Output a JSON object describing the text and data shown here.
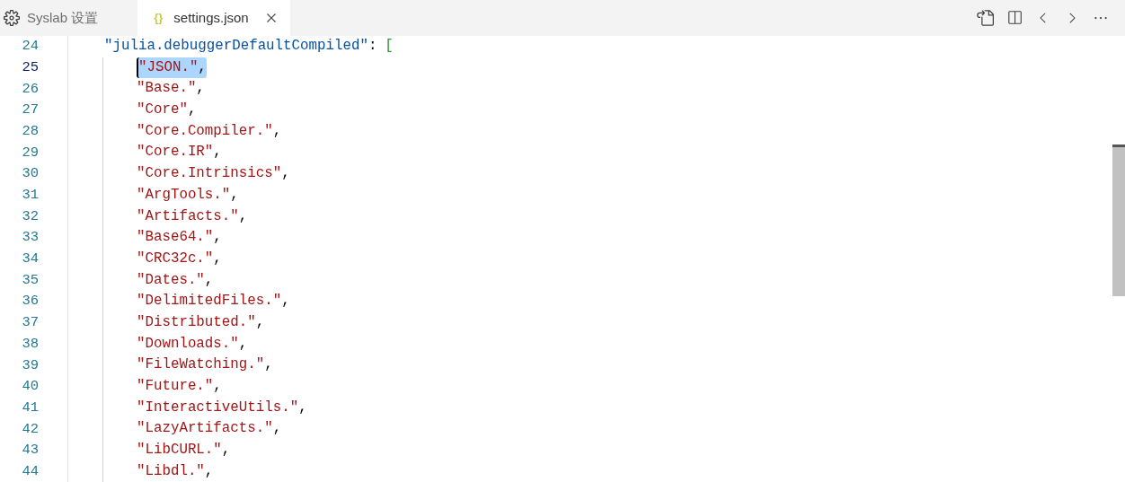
{
  "tabs": [
    {
      "kind": "settings",
      "label": "Syslab 设置",
      "selected": false
    },
    {
      "kind": "json",
      "icon_text": "{}",
      "label": "settings.json",
      "selected": true
    }
  ],
  "editor": {
    "lines": [
      {
        "number": "24",
        "active": false,
        "tokens": [
          {
            "kind": "key",
            "text": "\"julia.debuggerDefaultCompiled\"",
            "selected": false
          },
          {
            "kind": "punct",
            "text": ":",
            "selected": false
          },
          {
            "kind": "bracket",
            "text": "[",
            "selected": false
          }
        ]
      },
      {
        "number": "25",
        "active": true,
        "tokens": [
          {
            "kind": "string",
            "text": "\"JSON.\"",
            "selected": true
          },
          {
            "kind": "punct",
            "text": ",",
            "selected": true
          }
        ]
      },
      {
        "number": "26",
        "active": false,
        "tokens": [
          {
            "kind": "string",
            "text": "\"Base.\"",
            "selected": false
          },
          {
            "kind": "punct",
            "text": ",",
            "selected": false
          }
        ]
      },
      {
        "number": "27",
        "active": false,
        "tokens": [
          {
            "kind": "string",
            "text": "\"Core\"",
            "selected": false
          },
          {
            "kind": "punct",
            "text": ",",
            "selected": false
          }
        ]
      },
      {
        "number": "28",
        "active": false,
        "tokens": [
          {
            "kind": "string",
            "text": "\"Core.Compiler.\"",
            "selected": false
          },
          {
            "kind": "punct",
            "text": ",",
            "selected": false
          }
        ]
      },
      {
        "number": "29",
        "active": false,
        "tokens": [
          {
            "kind": "string",
            "text": "\"Core.IR\"",
            "selected": false
          },
          {
            "kind": "punct",
            "text": ",",
            "selected": false
          }
        ]
      },
      {
        "number": "30",
        "active": false,
        "tokens": [
          {
            "kind": "string",
            "text": "\"Core.Intrinsics\"",
            "selected": false
          },
          {
            "kind": "punct",
            "text": ",",
            "selected": false
          }
        ]
      },
      {
        "number": "31",
        "active": false,
        "tokens": [
          {
            "kind": "string",
            "text": "\"ArgTools.\"",
            "selected": false
          },
          {
            "kind": "punct",
            "text": ",",
            "selected": false
          }
        ]
      },
      {
        "number": "32",
        "active": false,
        "tokens": [
          {
            "kind": "string",
            "text": "\"Artifacts.\"",
            "selected": false
          },
          {
            "kind": "punct",
            "text": ",",
            "selected": false
          }
        ]
      },
      {
        "number": "33",
        "active": false,
        "tokens": [
          {
            "kind": "string",
            "text": "\"Base64.\"",
            "selected": false
          },
          {
            "kind": "punct",
            "text": ",",
            "selected": false
          }
        ]
      },
      {
        "number": "34",
        "active": false,
        "tokens": [
          {
            "kind": "string",
            "text": "\"CRC32c.\"",
            "selected": false
          },
          {
            "kind": "punct",
            "text": ",",
            "selected": false
          }
        ]
      },
      {
        "number": "35",
        "active": false,
        "tokens": [
          {
            "kind": "string",
            "text": "\"Dates.\"",
            "selected": false
          },
          {
            "kind": "punct",
            "text": ",",
            "selected": false
          }
        ]
      },
      {
        "number": "36",
        "active": false,
        "tokens": [
          {
            "kind": "string",
            "text": "\"DelimitedFiles.\"",
            "selected": false
          },
          {
            "kind": "punct",
            "text": ",",
            "selected": false
          }
        ]
      },
      {
        "number": "37",
        "active": false,
        "tokens": [
          {
            "kind": "string",
            "text": "\"Distributed.\"",
            "selected": false
          },
          {
            "kind": "punct",
            "text": ",",
            "selected": false
          }
        ]
      },
      {
        "number": "38",
        "active": false,
        "tokens": [
          {
            "kind": "string",
            "text": "\"Downloads.\"",
            "selected": false
          },
          {
            "kind": "punct",
            "text": ",",
            "selected": false
          }
        ]
      },
      {
        "number": "39",
        "active": false,
        "tokens": [
          {
            "kind": "string",
            "text": "\"FileWatching.\"",
            "selected": false
          },
          {
            "kind": "punct",
            "text": ",",
            "selected": false
          }
        ]
      },
      {
        "number": "40",
        "active": false,
        "tokens": [
          {
            "kind": "string",
            "text": "\"Future.\"",
            "selected": false
          },
          {
            "kind": "punct",
            "text": ",",
            "selected": false
          }
        ]
      },
      {
        "number": "41",
        "active": false,
        "tokens": [
          {
            "kind": "string",
            "text": "\"InteractiveUtils.\"",
            "selected": false
          },
          {
            "kind": "punct",
            "text": ",",
            "selected": false
          }
        ]
      },
      {
        "number": "42",
        "active": false,
        "tokens": [
          {
            "kind": "string",
            "text": "\"LazyArtifacts.\"",
            "selected": false
          },
          {
            "kind": "punct",
            "text": ",",
            "selected": false
          }
        ]
      },
      {
        "number": "43",
        "active": false,
        "tokens": [
          {
            "kind": "string",
            "text": "\"LibCURL.\"",
            "selected": false
          },
          {
            "kind": "punct",
            "text": ",",
            "selected": false
          }
        ]
      },
      {
        "number": "44",
        "active": false,
        "tokens": [
          {
            "kind": "string",
            "text": "\"Libdl.\"",
            "selected": false
          },
          {
            "kind": "punct",
            "text": ",",
            "selected": false
          }
        ]
      }
    ]
  }
}
